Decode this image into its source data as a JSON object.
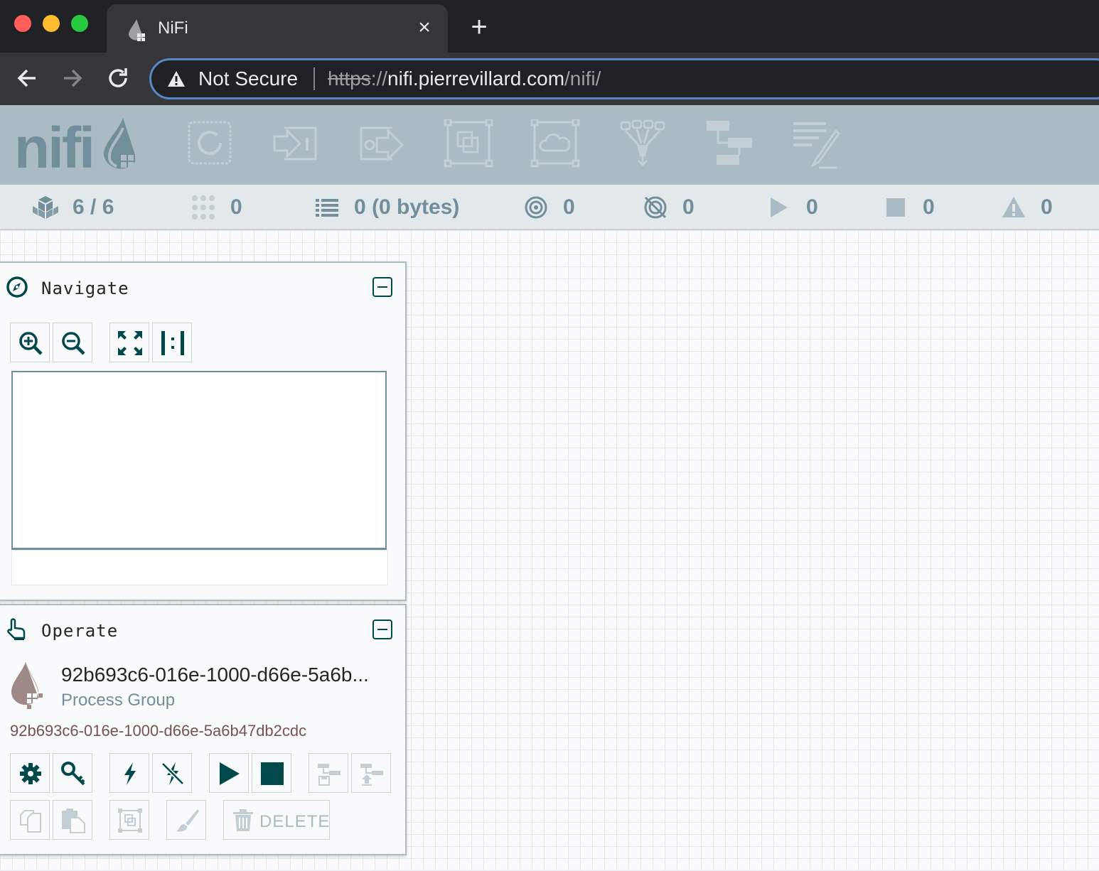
{
  "browser": {
    "tab_title": "NiFi",
    "security_label": "Not Secure",
    "url_scheme": "https",
    "url_sep": "://",
    "url_host": "nifi.pierrevillard.com",
    "url_path": "/nifi/"
  },
  "header": {
    "logo_text": "nifi",
    "components": [
      "processor-icon",
      "input-port-icon",
      "output-port-icon",
      "process-group-icon",
      "remote-process-group-icon",
      "funnel-icon",
      "template-icon",
      "label-icon"
    ]
  },
  "status": {
    "nodes": "6 / 6",
    "threads": "0",
    "queued": "0 (0 bytes)",
    "transmitting": "0",
    "not_transmitting": "0",
    "running": "0",
    "stopped": "0",
    "invalid": "0"
  },
  "navigate": {
    "title": "Navigate"
  },
  "operate": {
    "title": "Operate",
    "selection_name": "92b693c6-016e-1000-d66e-5a6b...",
    "selection_type": "Process Group",
    "selection_id": "92b693c6-016e-1000-d66e-5a6b47db2cdc",
    "delete_label": "DELETE"
  },
  "colors": {
    "header_bg": "#aabbc3",
    "status_bg": "#e3e8eb",
    "accent_dark": "#004849",
    "status_text": "#728e9b",
    "selection_id": "#775351"
  }
}
